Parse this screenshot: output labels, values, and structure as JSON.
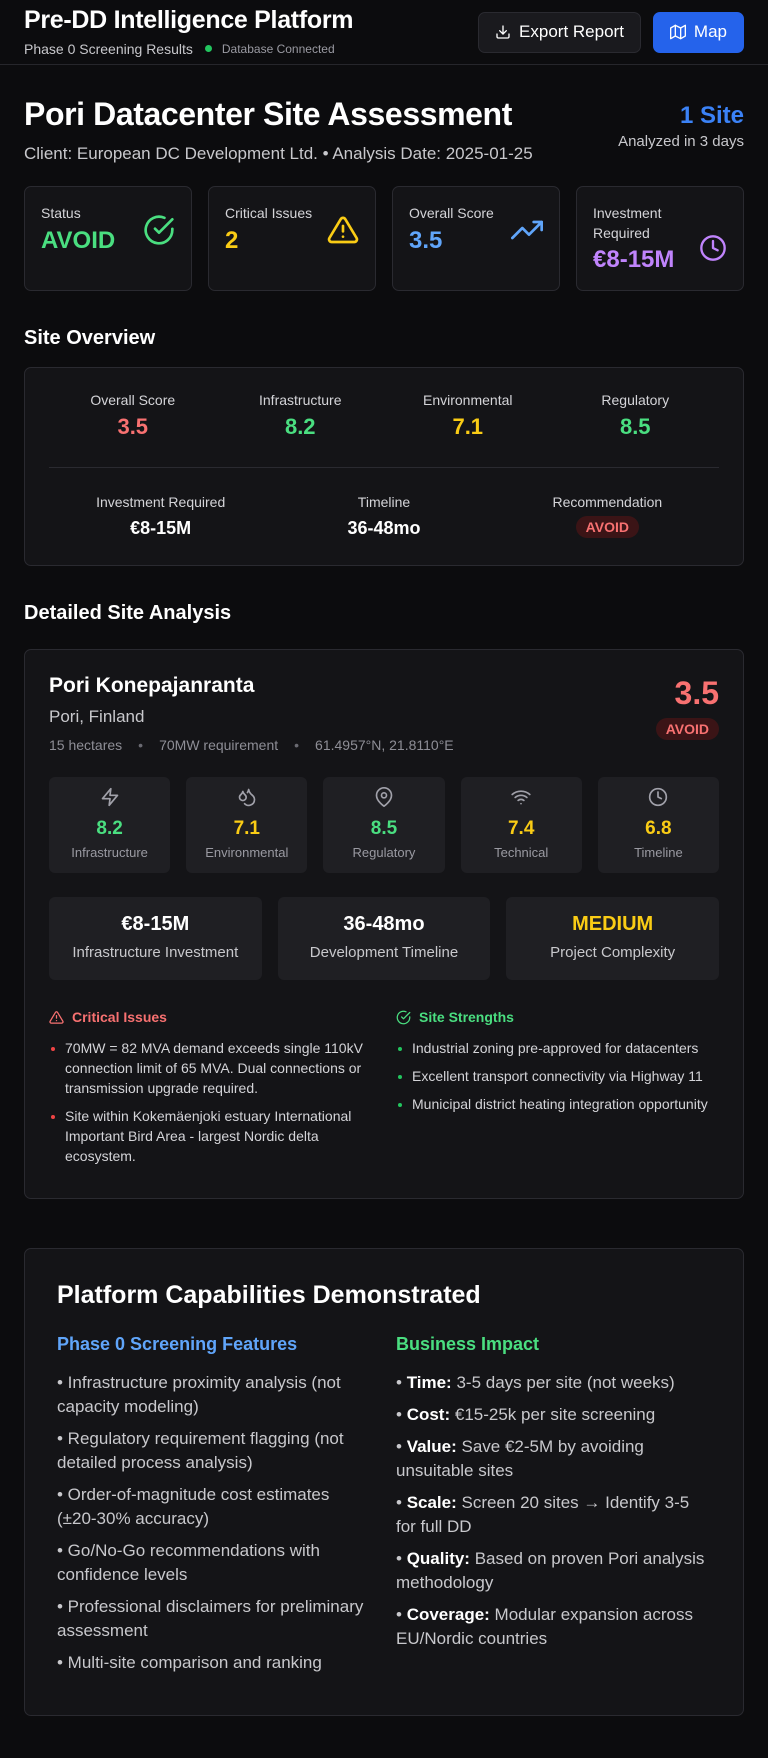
{
  "header": {
    "title": "Pre-DD Intelligence Platform",
    "subtitle": "Phase 0 Screening Results",
    "db_status": "Database Connected",
    "export_label": "Export Report",
    "map_label": "Map"
  },
  "page": {
    "title": "Pori Datacenter Site Assessment",
    "meta": "Client: European DC Development Ltd. • Analysis Date: 2025-01-25",
    "site_count": "1 Site",
    "analyzed": "Analyzed in 3 days"
  },
  "stats": [
    {
      "label": "Status",
      "value": "AVOID",
      "color": "#4ade80",
      "icon": "check-circle-icon"
    },
    {
      "label": "Critical Issues",
      "value": "2",
      "color": "#facc15",
      "icon": "warning-icon"
    },
    {
      "label": "Overall Score",
      "value": "3.5",
      "color": "#60a5fa",
      "icon": "trending-up-icon"
    },
    {
      "label": "Investment Required",
      "value": "€8-15M",
      "color": "#c084fc",
      "icon": "clock-icon"
    }
  ],
  "overview": {
    "title": "Site Overview",
    "scores": [
      {
        "label": "Overall Score",
        "value": "3.5",
        "color": "#f87171"
      },
      {
        "label": "Infrastructure",
        "value": "8.2",
        "color": "#4ade80"
      },
      {
        "label": "Environmental",
        "value": "7.1",
        "color": "#facc15"
      },
      {
        "label": "Regulatory",
        "value": "8.5",
        "color": "#4ade80"
      }
    ],
    "investment_label": "Investment Required",
    "investment_value": "€8-15M",
    "timeline_label": "Timeline",
    "timeline_value": "36-48mo",
    "recommendation_label": "Recommendation",
    "recommendation_value": "AVOID"
  },
  "detail": {
    "section_title": "Detailed Site Analysis",
    "name": "Pori Konepajanranta",
    "location": "Pori, Finland",
    "area": "15 hectares",
    "power": "70MW requirement",
    "coords": "61.4957°N, 21.8110°E",
    "score": "3.5",
    "badge": "AVOID",
    "metrics": [
      {
        "label": "Infrastructure",
        "value": "8.2",
        "color": "#4ade80",
        "icon": "lightning-icon"
      },
      {
        "label": "Environmental",
        "value": "7.1",
        "color": "#facc15",
        "icon": "droplet-icon"
      },
      {
        "label": "Regulatory",
        "value": "8.5",
        "color": "#4ade80",
        "icon": "map-pin-icon"
      },
      {
        "label": "Technical",
        "value": "7.4",
        "color": "#facc15",
        "icon": "wifi-icon"
      },
      {
        "label": "Timeline",
        "value": "6.8",
        "color": "#facc15",
        "icon": "clock-icon"
      }
    ],
    "summary": [
      {
        "value": "€8-15M",
        "label": "Infrastructure Investment",
        "color": "#ffffff"
      },
      {
        "value": "36-48mo",
        "label": "Development Timeline",
        "color": "#ffffff"
      },
      {
        "value": "MEDIUM",
        "label": "Project Complexity",
        "color": "#facc15"
      }
    ],
    "critical_title": "Critical Issues",
    "critical": [
      "70MW = 82 MVA demand exceeds single 110kV connection limit of 65 MVA. Dual connections or transmission upgrade required.",
      "Site within Kokemäenjoki estuary International Important Bird Area - largest Nordic delta ecosystem."
    ],
    "strengths_title": "Site Strengths",
    "strengths": [
      "Industrial zoning pre-approved for datacenters",
      "Excellent transport connectivity via Highway 11",
      "Municipal district heating integration opportunity"
    ]
  },
  "capabilities": {
    "title": "Platform Capabilities Demonstrated",
    "features_title": "Phase 0 Screening Features",
    "features": [
      "• Infrastructure proximity analysis (not capacity modeling)",
      "• Regulatory requirement flagging (not detailed process analysis)",
      "• Order-of-magnitude cost estimates (±20-30% accuracy)",
      "• Go/No-Go recommendations with confidence levels",
      "• Professional disclaimers for preliminary assessment",
      "• Multi-site comparison and ranking"
    ],
    "impact_title": "Business Impact",
    "impact": [
      {
        "key": "Time:",
        "text": " 3-5 days per site (not weeks)"
      },
      {
        "key": "Cost:",
        "text": " €15-25k per site screening"
      },
      {
        "key": "Value:",
        "text": " Save €2-5M by avoiding unsuitable sites"
      },
      {
        "key": "Scale:",
        "text": " Screen 20 sites → Identify 3-5 for full DD"
      },
      {
        "key": "Quality:",
        "text": " Based on proven Pori analysis methodology"
      },
      {
        "key": "Coverage:",
        "text": " Modular expansion across EU/Nordic countries"
      }
    ]
  }
}
